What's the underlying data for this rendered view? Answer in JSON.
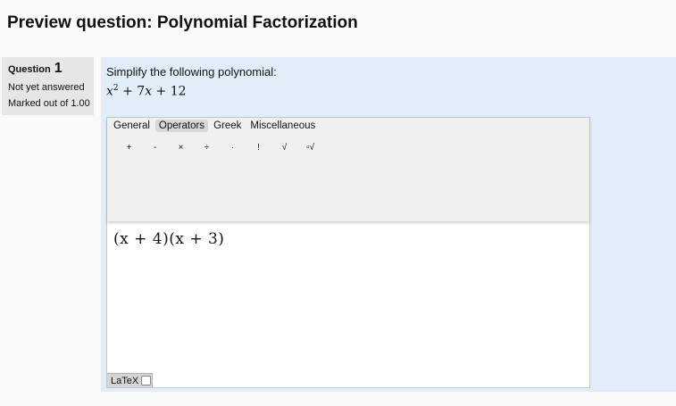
{
  "page": {
    "title": "Preview question: Polynomial Factorization"
  },
  "info": {
    "question_label": "Question",
    "question_number": "1",
    "state": "Not yet answered",
    "grade": "Marked out of 1.00"
  },
  "question": {
    "prompt": "Simplify the following polynomial:",
    "formula": {
      "base": "x",
      "exp": "2",
      "rest_plus1": " + 7",
      "rest_var": "x",
      "rest_plus2": " + 12"
    }
  },
  "editor": {
    "tabs": [
      {
        "label": "General",
        "active": false
      },
      {
        "label": "Operators",
        "active": true
      },
      {
        "label": "Greek",
        "active": false
      },
      {
        "label": "Miscellaneous",
        "active": false
      }
    ],
    "operators": [
      "+",
      "-",
      "×",
      "÷",
      "·",
      "!",
      "√",
      "▫√"
    ],
    "answer": "(x + 4)(x + 3)",
    "latex_label": "LaTeX",
    "latex_checked": false
  }
}
